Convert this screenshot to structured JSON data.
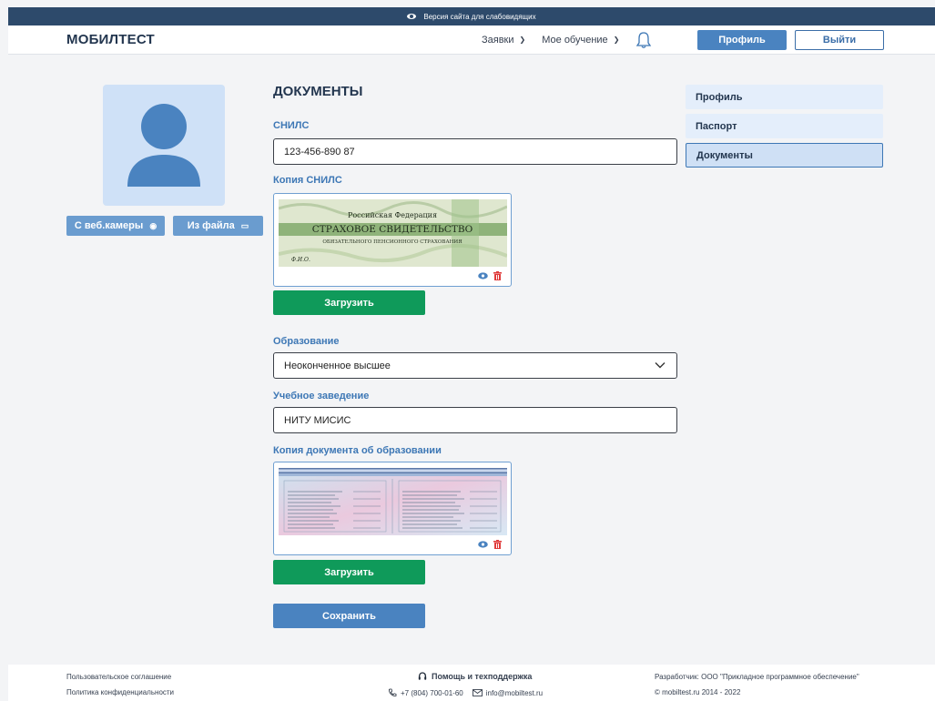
{
  "accessibility": {
    "label": "Версия сайта для слабовидящих",
    "icon": "eye-icon"
  },
  "header": {
    "logo": "МОБИЛТЕСТ",
    "nav": [
      {
        "label": "Заявки"
      },
      {
        "label": "Мое обучение"
      }
    ],
    "profile_button": "Профиль",
    "logout_button": "Выйти"
  },
  "photo": {
    "webcam_button": "С веб.камеры",
    "file_button": "Из файла"
  },
  "main": {
    "title": "ДОКУМЕНТЫ",
    "snils_label": "СНИЛС",
    "snils_value": "123-456-890 87",
    "snils_copy_label": "Копия СНИЛС",
    "snils_card": {
      "line1": "Российская Федерация",
      "line2": "СТРАХОВОЕ СВИДЕТЕЛЬСТВО",
      "line3": "ОБЯЗАТЕЛЬНОГО ПЕНСИОННОГО СТРАХОВАНИЯ",
      "line4": "Ф.И.О."
    },
    "upload_button": "Загрузить",
    "education_label": "Образование",
    "education_value": "Неоконченное высшее",
    "institution_label": "Учебное заведение",
    "institution_value": "НИТУ МИСИС",
    "edu_copy_label": "Копия документа об образовании",
    "upload_button_2": "Загрузить",
    "save_button": "Сохранить"
  },
  "sidebar": {
    "items": [
      {
        "label": "Профиль"
      },
      {
        "label": "Паспорт"
      },
      {
        "label": "Документы"
      }
    ]
  },
  "footer": {
    "agreement": "Пользовательское соглашение",
    "privacy": "Политика конфиденциальности",
    "help": "Помощь и техподдержка",
    "phone": "+7 (804) 700-01-60",
    "email": "info@mobiltest.ru",
    "developer": "Разработчик: ООО \"Прикладное программное обеспечение\"",
    "copyright": "© mobiltest.ru 2014 - 2022"
  },
  "colors": {
    "primary": "#4a83c0",
    "green": "#0f9a5a",
    "navy": "#2d4a6b",
    "delete": "#e03c3c"
  }
}
